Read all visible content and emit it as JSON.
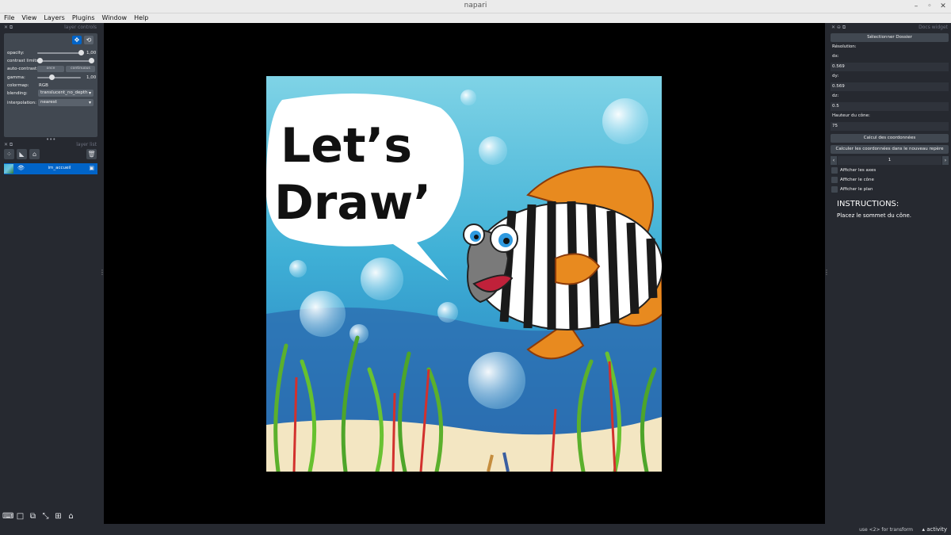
{
  "window": {
    "title": "napari"
  },
  "menu": [
    "File",
    "View",
    "Layers",
    "Plugins",
    "Window",
    "Help"
  ],
  "layer_controls": {
    "header": "layer controls",
    "opacity_label": "opacity:",
    "opacity_value": "1,00",
    "opacity_fraction": 1.0,
    "contrast_label": "contrast limits:",
    "contrast_range": [
      0.0,
      1.0
    ],
    "autocontrast_label": "auto-contrast:",
    "once_label": "once",
    "continuous_label": "continuous",
    "gamma_label": "gamma:",
    "gamma_value": "1,00",
    "gamma_fraction": 0.33,
    "colormap_label": "colormap:",
    "colormap_value": "RGB",
    "blending_label": "blending:",
    "blending_value": "translucent_no_depth",
    "interpolation_label": "interpolation:",
    "interpolation_value": "nearest"
  },
  "layer_list": {
    "header": "layer list",
    "layers": [
      {
        "name": "im_accueil",
        "selected": true,
        "visible": true
      }
    ]
  },
  "image": {
    "speech_line1": "Let’s",
    "speech_line2": "Draw’"
  },
  "dock_widget": {
    "header": "Docs widget",
    "select_folder_button": "Sélectionner Dossier",
    "resolution_label": "Résolution:",
    "dx_label": "dx:",
    "dx_value": "0.569",
    "dy_label": "dy:",
    "dy_value": "0.569",
    "dz_label": "dz:",
    "dz_value": "0.5",
    "cone_height_label": "Hauteur du cône:",
    "cone_height_value": "75",
    "compute_button": "Calcul des coordonnées",
    "compute_new_frame_button": "Calculer les coordonnées dans le nouveau repère",
    "spin_value": "1",
    "checkboxes": [
      "Afficher les axes",
      "Afficher le cône",
      "Afficher le plan"
    ],
    "instructions_title": "INSTRUCTIONS:",
    "instructions_text": "Placez le sommet du cône."
  },
  "status": {
    "text": "use <2> for transform",
    "activity": "activity"
  },
  "colors": {
    "panel_bg": "#262930",
    "control_bg": "#414851",
    "selected_layer": "#0064c8",
    "canvas_bg": "#000000"
  }
}
